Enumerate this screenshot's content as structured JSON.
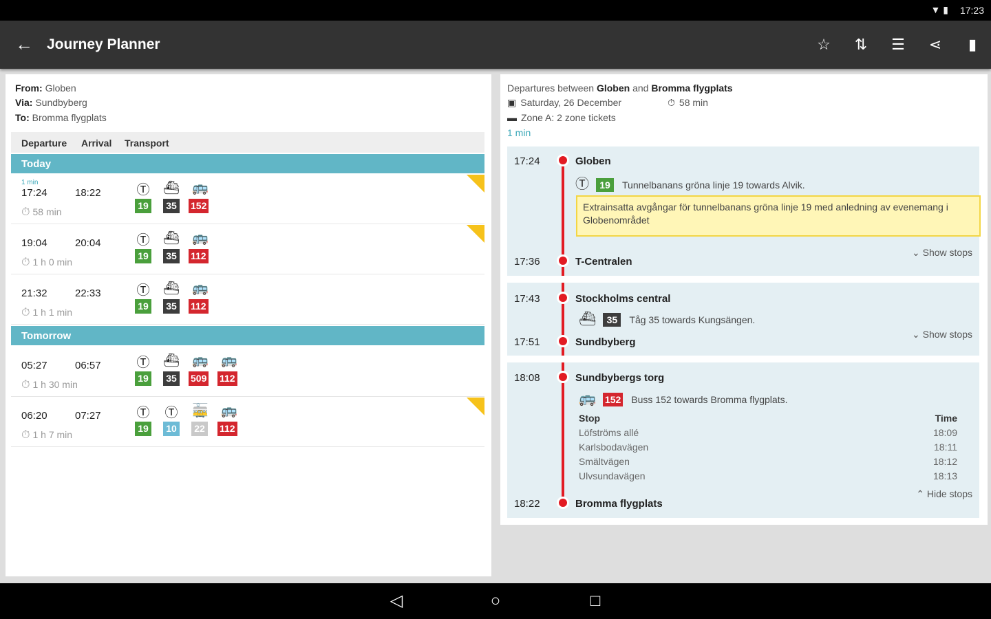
{
  "status": {
    "time": "17:23"
  },
  "toolbar": {
    "title": "Journey Planner"
  },
  "query": {
    "from_label": "From:",
    "from_value": "Globen",
    "via_label": "Via:",
    "via_value": "Sundbyberg",
    "to_label": "To:",
    "to_value": "Bromma flygplats"
  },
  "table": {
    "col_departure": "Departure",
    "col_arrival": "Arrival",
    "col_transport": "Transport"
  },
  "days": [
    {
      "label": "Today",
      "trips": [
        {
          "countdown": "1 min",
          "dep": "17:24",
          "arr": "18:22",
          "dur": "58 min",
          "warning": true,
          "lines": [
            "19",
            "35",
            "152"
          ]
        },
        {
          "dep": "19:04",
          "arr": "20:04",
          "dur": "1 h 0 min",
          "warning": true,
          "lines": [
            "19",
            "35",
            "112"
          ]
        },
        {
          "dep": "21:32",
          "arr": "22:33",
          "dur": "1 h 1 min",
          "warning": false,
          "lines": [
            "19",
            "35",
            "112"
          ]
        }
      ]
    },
    {
      "label": "Tomorrow",
      "trips": [
        {
          "dep": "05:27",
          "arr": "06:57",
          "dur": "1 h 30 min",
          "warning": false,
          "lines": [
            "19",
            "35",
            "509",
            "112"
          ]
        },
        {
          "dep": "06:20",
          "arr": "07:27",
          "dur": "1 h 7 min",
          "warning": true,
          "lines": [
            "19",
            "10",
            "22",
            "112"
          ]
        }
      ]
    }
  ],
  "detail": {
    "header_prefix": "Departures between",
    "origin": "Globen",
    "and": "and",
    "destination": "Bromma flygplats",
    "date": "Saturday, 26 December",
    "duration": "58 min",
    "zone": "Zone A: 2 zone tickets",
    "countdown": "1 min",
    "legs": [
      {
        "from_time": "17:24",
        "from": "Globen",
        "line": "19",
        "line_text": "Tunnelbanans gröna linje 19 towards Alvik.",
        "alert": "Extrainsatta avgångar för tunnelbanans gröna linje 19 med anledning av evenemang i Globenområdet",
        "to_time": "17:36",
        "to": "T-Centralen",
        "toggle": "Show stops"
      },
      {
        "from_time": "17:43",
        "from": "Stockholms central",
        "line": "35",
        "line_text": "Tåg 35 towards Kungsängen.",
        "to_time": "17:51",
        "to": "Sundbyberg",
        "toggle": "Show stops"
      },
      {
        "from_time": "18:08",
        "from": "Sundbybergs torg",
        "line": "152",
        "line_text": "Buss 152 towards Bromma flygplats.",
        "stop_col": "Stop",
        "time_col": "Time",
        "stops": [
          {
            "name": "Löfströms allé",
            "time": "18:09"
          },
          {
            "name": "Karlsbodavägen",
            "time": "18:11"
          },
          {
            "name": "Smältvägen",
            "time": "18:12"
          },
          {
            "name": "Ulvsundavägen",
            "time": "18:13"
          }
        ],
        "toggle": "Hide stops",
        "to_time": "18:22",
        "to": "Bromma flygplats"
      }
    ]
  },
  "colors": {
    "metro_green": "#4a9f3c",
    "train_dark": "#3d3d3d",
    "bus_red": "#d4262e",
    "metro_blue": "#6dbbd6",
    "tram_grey": "#c9c9c9",
    "day_header": "#61b6c6",
    "route_line": "#e21b23",
    "alert_bg": "#fff6b7"
  }
}
